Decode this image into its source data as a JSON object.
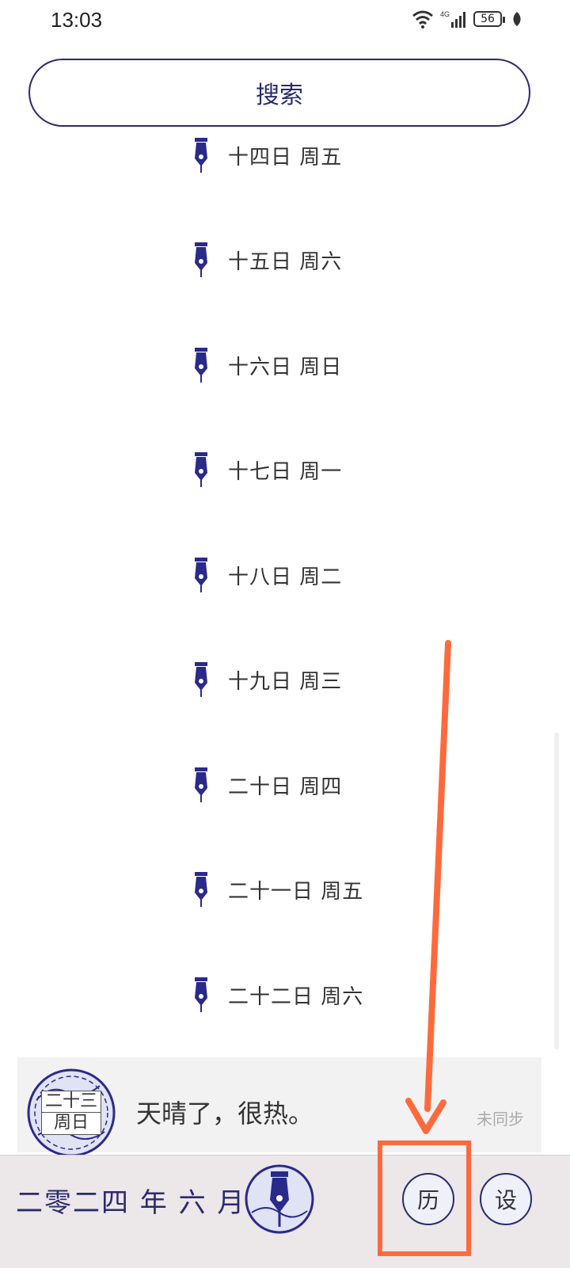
{
  "status_bar": {
    "time": "13:03",
    "network": "4G",
    "battery": "56"
  },
  "search": {
    "label": "搜索"
  },
  "entries": [
    {
      "label": "十四日 周五"
    },
    {
      "label": "十五日 周六"
    },
    {
      "label": "十六日 周日"
    },
    {
      "label": "十七日 周一"
    },
    {
      "label": "十八日 周二"
    },
    {
      "label": "十九日 周三"
    },
    {
      "label": "二十日 周四"
    },
    {
      "label": "二十一日 周五"
    },
    {
      "label": "二十二日 周六"
    }
  ],
  "journal_card": {
    "day": "二十三",
    "weekday": "周日",
    "text": "天晴了，很热。",
    "sync_status": "未同步"
  },
  "bottom_bar": {
    "month_title": "二零二四 年 六 月",
    "calendar_label": "历",
    "settings_label": "设"
  },
  "colors": {
    "accent": "#2a2a6e",
    "annotation": "#ff6a3d"
  }
}
